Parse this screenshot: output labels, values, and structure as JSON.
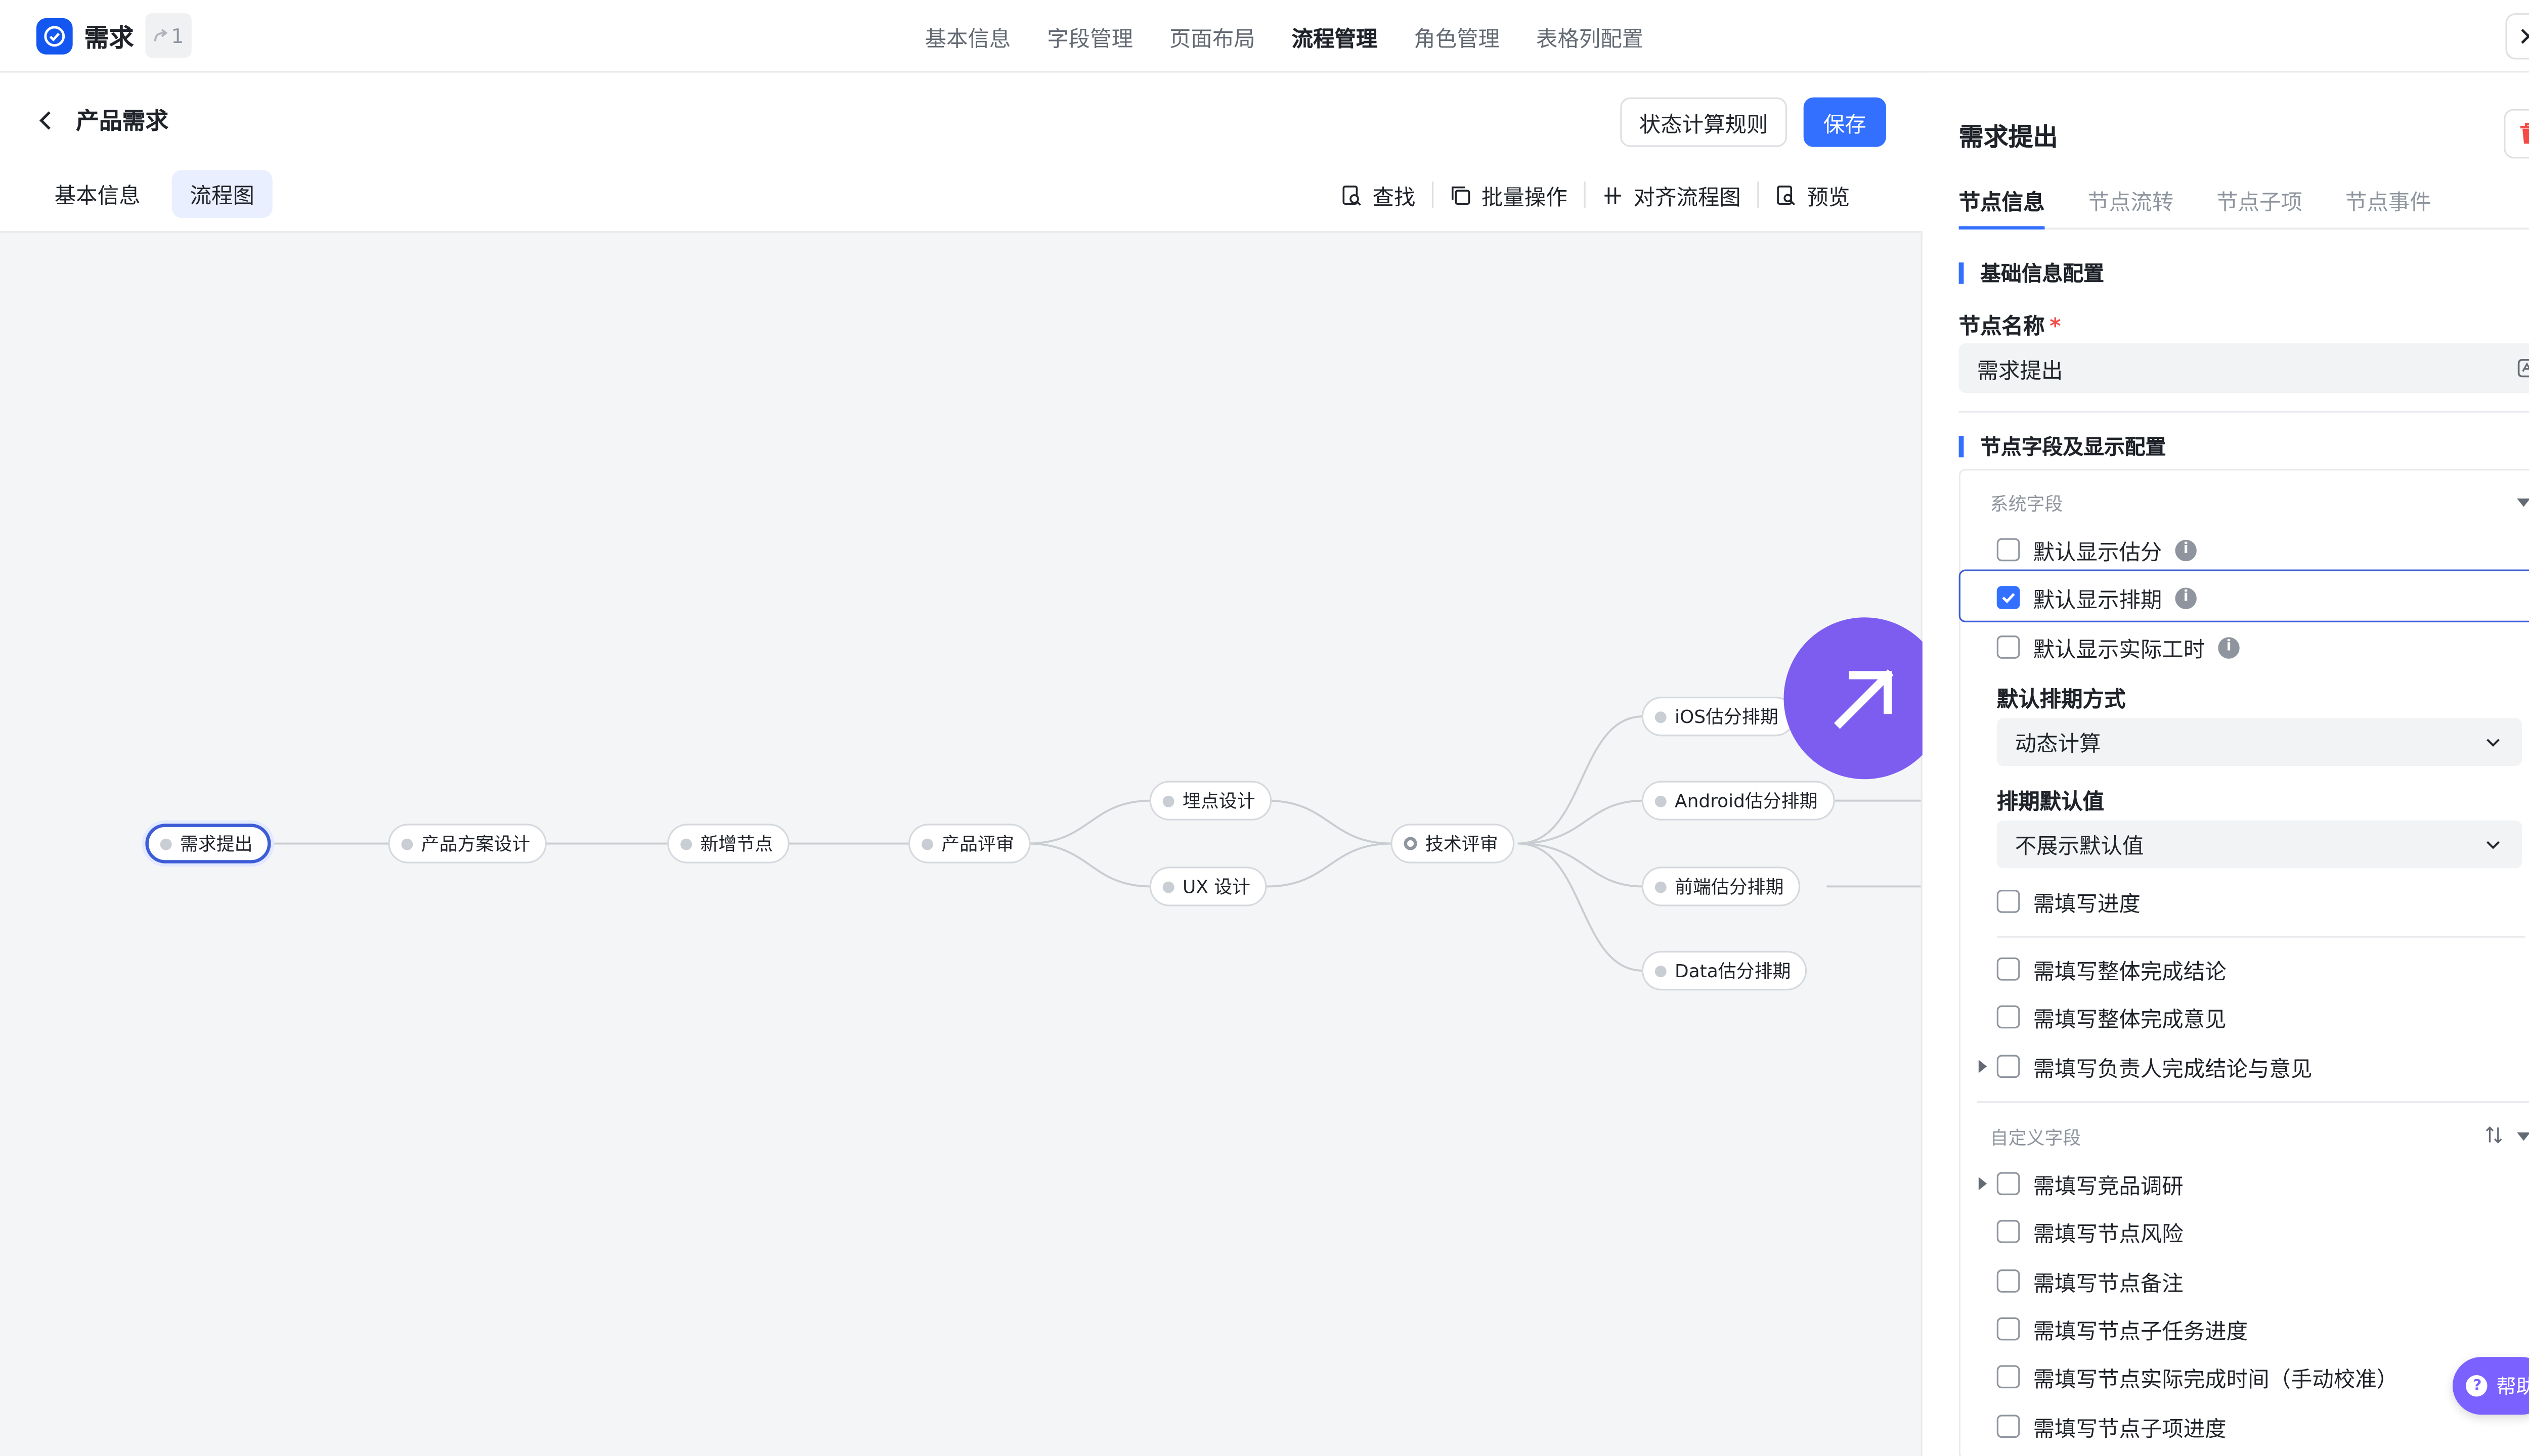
{
  "app": {
    "title": "需求",
    "version_count": "1"
  },
  "top_nav": [
    "基本信息",
    "字段管理",
    "页面布局",
    "流程管理",
    "角色管理",
    "表格列配置"
  ],
  "top_nav_active": "流程管理",
  "page": {
    "title": "产品需求",
    "rule_button": "状态计算规则",
    "save_button": "保存"
  },
  "subtabs": [
    "基本信息",
    "流程图"
  ],
  "toolbar": {
    "find": "查找",
    "batch": "批量操作",
    "align": "对齐流程图",
    "preview": "预览"
  },
  "flow": {
    "nodes": {
      "n1": "需求提出",
      "n2": "产品方案设计",
      "n3": "新增节点",
      "n4": "产品评审",
      "n5": "埋点设计",
      "n6": "UX 设计",
      "n7": "技术评审",
      "n8": "iOS估分排期",
      "n9": "Android估分排期",
      "n10": "前端估分排期",
      "n11": "Data估分排期"
    },
    "selected": "需求提出"
  },
  "panel": {
    "title": "需求提出",
    "tabs": [
      "节点信息",
      "节点流转",
      "节点子项",
      "节点事件"
    ],
    "active_tab": "节点信息",
    "basic_section": "基础信息配置",
    "node_name_label": "节点名称",
    "required_mark": "*",
    "node_name_value": "需求提出",
    "fields_section": "节点字段及显示配置",
    "system_group": "系统字段",
    "system_fields": [
      {
        "label": "默认显示估分",
        "checked": false
      },
      {
        "label": "默认显示排期",
        "checked": true
      },
      {
        "label": "默认显示实际工时",
        "checked": false
      }
    ],
    "schedule_mode_label": "默认排期方式",
    "schedule_mode_value": "动态计算",
    "schedule_default_label": "排期默认值",
    "schedule_default_value": "不展示默认值",
    "progress_field": {
      "label": "需填写进度",
      "checked": false
    },
    "completion_fields": [
      {
        "label": "需填写整体完成结论",
        "checked": false
      },
      {
        "label": "需填写整体完成意见",
        "checked": false
      },
      {
        "label": "需填写负责人完成结论与意见",
        "checked": false
      }
    ],
    "custom_group": "自定义字段",
    "custom_fields": [
      {
        "label": "需填写竞品调研",
        "checked": false
      },
      {
        "label": "需填写节点风险",
        "checked": false
      },
      {
        "label": "需填写节点备注",
        "checked": false
      },
      {
        "label": "需填写节点子任务进度",
        "checked": false
      },
      {
        "label": "需填写节点实际完成时间（手动校准）",
        "checked": false
      },
      {
        "label": "需填写节点子项进度",
        "checked": false
      }
    ]
  },
  "help": "帮助",
  "colors": {
    "primary": "#3370ff",
    "accent_purple": "#7c5df0",
    "canvas_bg": "#f4f5f7",
    "danger": "#f54a45"
  }
}
